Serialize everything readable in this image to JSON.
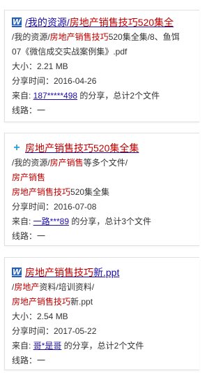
{
  "results": [
    {
      "icon": "word-doc-icon",
      "title_parts": [
        "/我的资源/",
        "房地产销售技巧520集全"
      ],
      "path_parts": [
        "/我的资源/",
        "房地产销售技巧",
        "520集全集/8、鱼饵"
      ],
      "file_line": "07《微信成交实战案例集》.pdf",
      "size": "大小：2.21 MB",
      "share_time": "分享时间：2016-04-26",
      "from_prefix": "来自: ",
      "from_user": "187*****498",
      "from_suffix": " 的分享，总计2个文件",
      "route": "线路：一"
    },
    {
      "icon": "plus-expand-icon",
      "title": "房地产销售技巧520集全集",
      "path_parts": [
        "/我的资源/",
        "房产销售",
        "等多个文件/"
      ],
      "line1": "房产销售",
      "line2_parts": [
        "房地产销售技巧",
        "520集全集"
      ],
      "share_time": "分享时间：2016-07-08",
      "from_prefix": "来自: ",
      "from_user": "一路***89",
      "from_suffix": " 的分享，总计3个文件",
      "route": "线路：一"
    },
    {
      "icon": "word-doc-icon",
      "title_parts": [
        "房地产销售技巧",
        "新.ppt"
      ],
      "path_parts": [
        "/",
        "房地产",
        "资料/培训资料/"
      ],
      "file_parts": [
        "房地产销售技巧",
        "新.ppt"
      ],
      "size": "大小：2.54 MB",
      "share_time": "分享时间：2017-05-22",
      "from_prefix": "来自: ",
      "from_user": "哥*是哥",
      "from_suffix": " 的分享，总计2个文件",
      "route": "线路：一"
    }
  ]
}
